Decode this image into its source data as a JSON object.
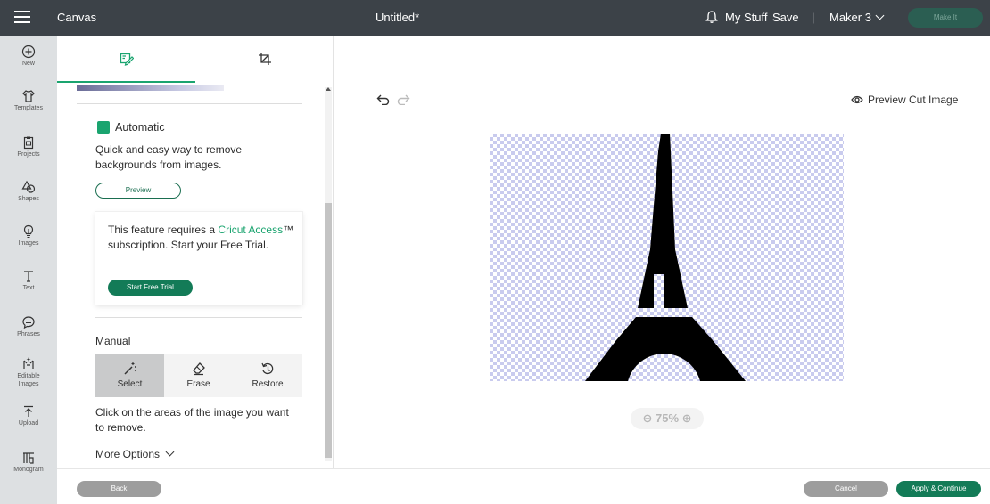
{
  "topbar": {
    "menu_icon": "hamburger-icon",
    "section": "Canvas",
    "document_title": "Untitled*",
    "notification_icon": "bell-icon",
    "my_stuff": "My Stuff",
    "save": "Save",
    "separator": "|",
    "machine": "Maker 3",
    "make_it": "Make It"
  },
  "rail": {
    "items": [
      {
        "label": "New",
        "icon": "plus-circle-icon"
      },
      {
        "label": "Templates",
        "icon": "shirt-icon"
      },
      {
        "label": "Projects",
        "icon": "clipboard-icon"
      },
      {
        "label": "Shapes",
        "icon": "shapes-icon"
      },
      {
        "label": "Images",
        "icon": "lightbulb-icon"
      },
      {
        "label": "Text",
        "icon": "text-icon"
      },
      {
        "label": "Phrases",
        "icon": "speech-bubble-icon"
      },
      {
        "label": "Editable Images",
        "icon": "sparkle-edit-icon"
      },
      {
        "label": "Upload",
        "icon": "upload-icon"
      },
      {
        "label": "Monogram",
        "icon": "monogram-icon"
      }
    ]
  },
  "panel": {
    "tabs": [
      {
        "name": "edit",
        "icon": "edit-image-icon",
        "active": true
      },
      {
        "name": "crop",
        "icon": "crop-icon",
        "active": false
      }
    ],
    "automatic": {
      "title": "Automatic",
      "description": "Quick and easy way to remove backgrounds from images.",
      "preview_button": "Preview"
    },
    "promo": {
      "text_before": "This feature requires a ",
      "link": "Cricut Access",
      "text_after": "™ subscription. Start your Free Trial.",
      "button": "Start Free Trial"
    },
    "manual": {
      "title": "Manual",
      "tools": [
        {
          "label": "Select",
          "icon": "magic-wand-icon",
          "active": true
        },
        {
          "label": "Erase",
          "icon": "eraser-icon",
          "active": false
        },
        {
          "label": "Restore",
          "icon": "restore-icon",
          "active": false
        }
      ],
      "description": "Click on the areas of the image you want to remove.",
      "more_options": "More Options"
    }
  },
  "canvas": {
    "preview_cut": "Preview Cut Image",
    "zoom": "75%",
    "image_subject": "eiffel-tower-silhouette"
  },
  "bottom": {
    "back": "Back",
    "cancel": "Cancel",
    "apply": "Apply & Continue"
  },
  "colors": {
    "topbar": "#3c4248",
    "accent_green": "#137b57",
    "highlight_green": "#1aa46f",
    "rail_bg": "#dde0e2",
    "checker": "#c9cbee"
  }
}
